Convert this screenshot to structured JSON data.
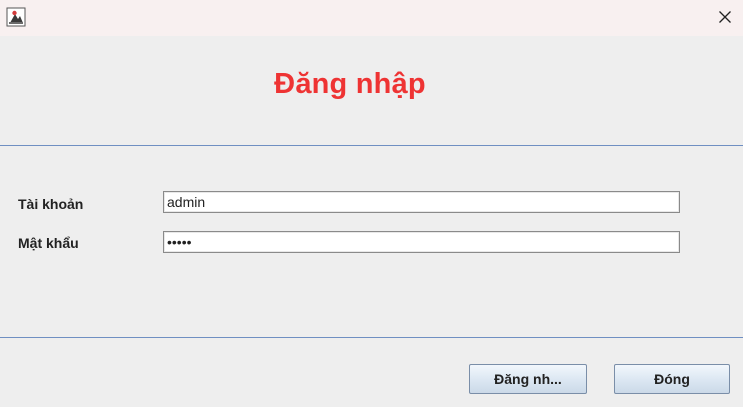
{
  "titlebar": {
    "icon": "java-app-icon",
    "close_icon": "close-icon"
  },
  "form": {
    "heading": "Đăng nhập",
    "heading_color": "#ee3333",
    "username_label": "Tài khoản",
    "username_value": "admin",
    "password_label": "Mật khẩu",
    "password_value": "admin"
  },
  "actions": {
    "login_label": "Đăng nh...",
    "close_label": "Đóng"
  }
}
